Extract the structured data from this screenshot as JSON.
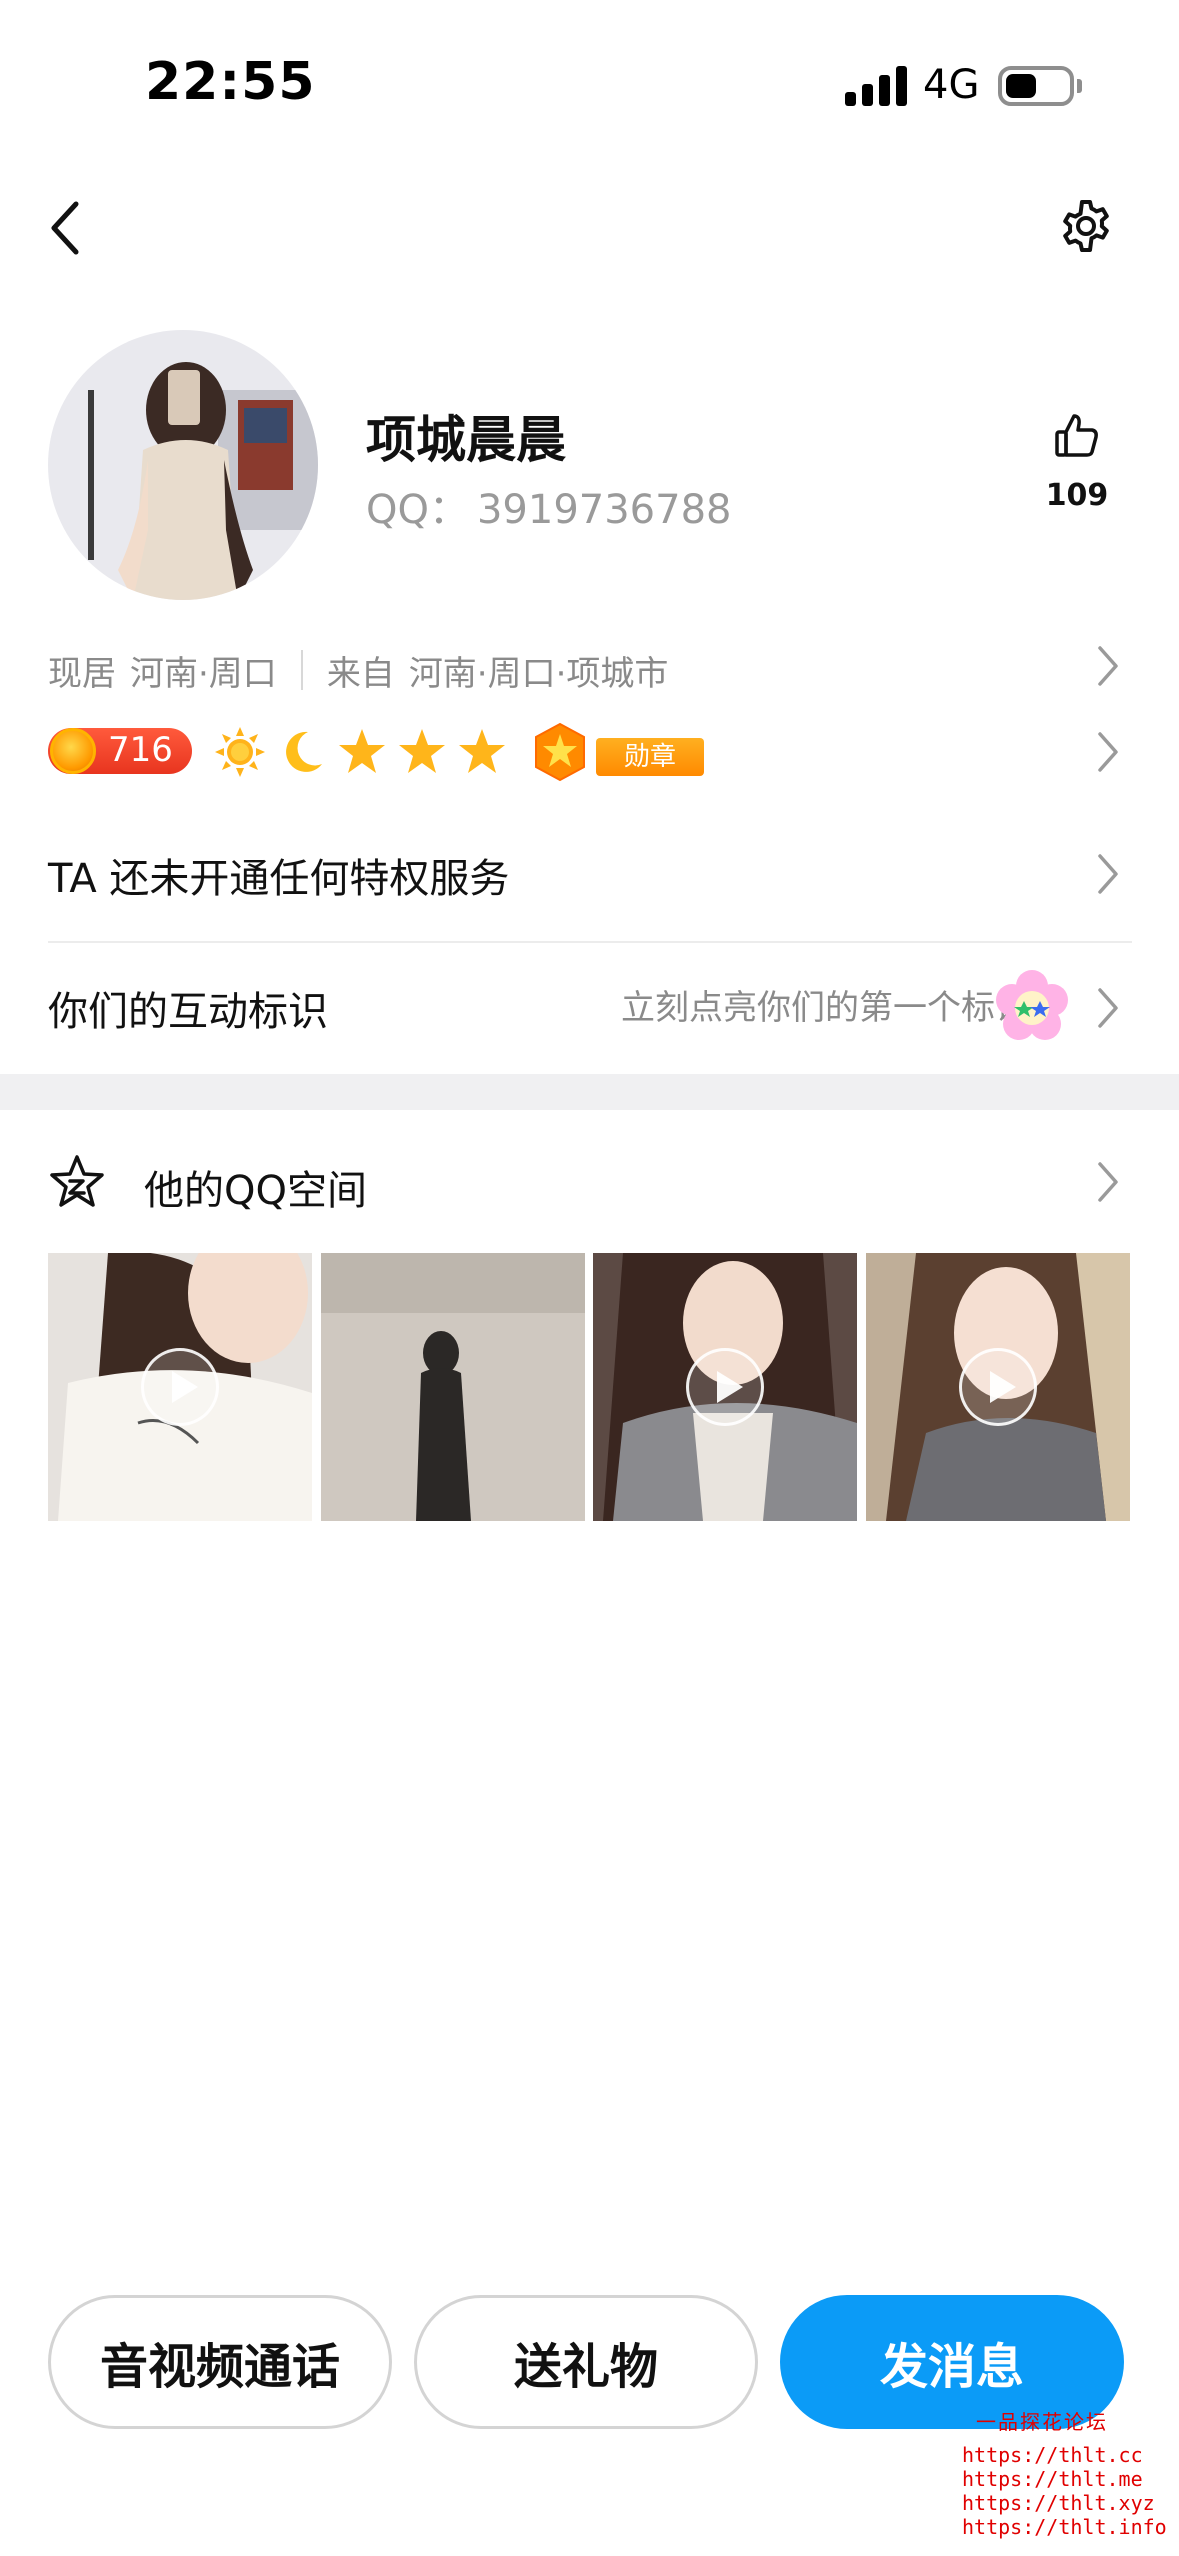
{
  "status_bar": {
    "time": "22:55",
    "network": "4G"
  },
  "profile": {
    "nickname": "项城晨晨",
    "qq_label": "QQ：",
    "qq_number": "3919736788",
    "likes": "109"
  },
  "location": {
    "current_label": "现居",
    "current_value": "河南·周口",
    "origin_label": "来自",
    "origin_value": "河南·周口·项城市"
  },
  "level": {
    "number": "716",
    "medal_label": "勋章"
  },
  "rows": {
    "privilege": "TA 还未开通任何特权服务",
    "interaction_title": "你们的互动标识",
    "interaction_hint": "立刻点亮你们的第一个标识"
  },
  "qzone": {
    "title": "他的QQ空间"
  },
  "actions": {
    "call": "音视频通话",
    "gift": "送礼物",
    "message": "发消息"
  },
  "watermark": {
    "title": "一品探花论坛",
    "urls": [
      "https://thlt.cc",
      "https://thlt.me",
      "https://thlt.xyz",
      "https://thlt.info"
    ]
  },
  "colors": {
    "primary": "#0b9bf7",
    "secondary_text": "#8a8a8a",
    "level_pill": "#e8351f",
    "medal": "#ff8a00"
  }
}
